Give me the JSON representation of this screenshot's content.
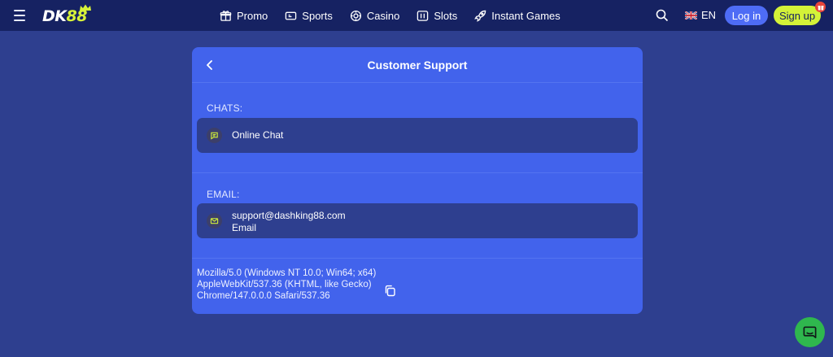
{
  "header": {
    "logo": {
      "prefix": "DK",
      "suffix": "88"
    },
    "nav": [
      {
        "id": "promo",
        "label": "Promo",
        "icon": "gift-icon"
      },
      {
        "id": "sports",
        "label": "Sports",
        "icon": "ticket-icon"
      },
      {
        "id": "casino",
        "label": "Casino",
        "icon": "chip-icon"
      },
      {
        "id": "slots",
        "label": "Slots",
        "icon": "slot-machine-icon"
      },
      {
        "id": "instant-games",
        "label": "Instant Games",
        "icon": "rocket-icon"
      }
    ],
    "language": "EN",
    "login_label": "Log in",
    "signup_label": "Sign up"
  },
  "support": {
    "title": "Customer Support",
    "chats_label": "CHATS:",
    "online_chat_label": "Online Chat",
    "email_label": "EMAIL:",
    "email_address": "support@dashking88.com",
    "email_type": "Email",
    "user_agent": "Mozilla/5.0 (Windows NT 10.0; Win64; x64) AppleWebKit/537.36 (KHTML, like Gecko) Chrome/147.0.0.0 Safari/537.36"
  },
  "colors": {
    "topbar": "#162262",
    "background": "#2e3f8f",
    "panel": "#4263ec",
    "accent_lime": "#d4f238",
    "login_blue": "#4e6cf5",
    "chat_green": "#2fb74e"
  }
}
